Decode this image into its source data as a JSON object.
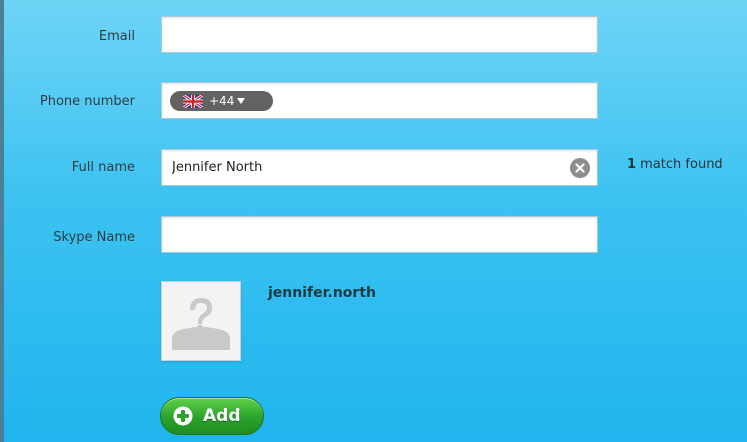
{
  "form": {
    "email": {
      "label": "Email",
      "value": ""
    },
    "phone": {
      "label": "Phone number",
      "dial_code": "+44",
      "value": ""
    },
    "full_name": {
      "label": "Full name",
      "value": "Jennifer North"
    },
    "skype_name": {
      "label": "Skype Name",
      "value": ""
    }
  },
  "search": {
    "match_count": "1",
    "match_suffix": " match found"
  },
  "result": {
    "username": "jennifer.north"
  },
  "actions": {
    "add_label": "Add"
  },
  "colors": {
    "background_top": "#6fd4f6",
    "background_bottom": "#20b5ee",
    "add_button": "#2ba22b",
    "pill": "#626262"
  }
}
